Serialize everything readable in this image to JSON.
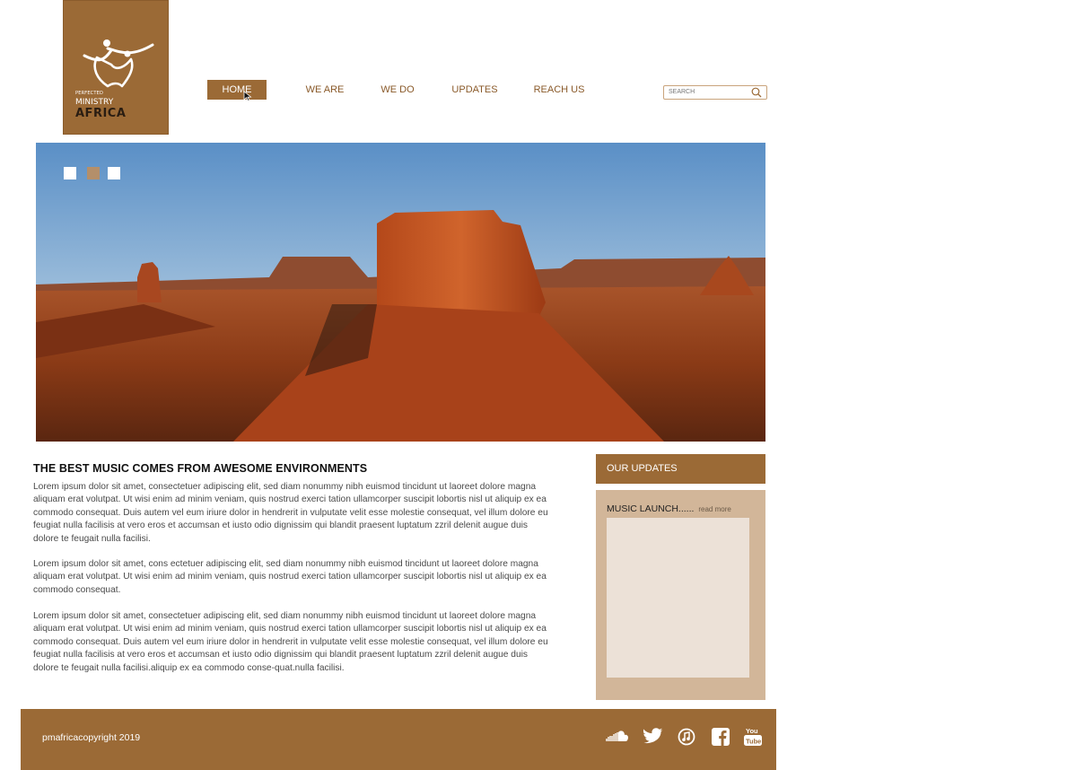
{
  "brand": {
    "tagline": "PERFECTED",
    "line1": "MINISTRY",
    "line2": "AFRICA"
  },
  "nav": {
    "items": [
      {
        "label": "HOME",
        "active": true
      },
      {
        "label": "WE ARE",
        "active": false
      },
      {
        "label": "WE DO",
        "active": false
      },
      {
        "label": "UPDATES",
        "active": false
      },
      {
        "label": "REACH US",
        "active": false
      }
    ]
  },
  "search": {
    "placeholder": "SEARCH",
    "icon": "search-icon"
  },
  "slider": {
    "slide_count": 3,
    "active_index": 1
  },
  "article": {
    "heading": "THE BEST MUSIC COMES FROM AWESOME ENVIRONMENTS",
    "paragraphs": [
      "Lorem ipsum dolor sit amet, consectetuer adipiscing elit, sed diam nonummy nibh euismod tincidunt ut laoreet dolore magna aliquam erat volutpat. Ut wisi enim ad minim veniam, quis nostrud exerci tation ullamcorper suscipit lobortis nisl ut aliquip ex ea commodo consequat. Duis autem vel eum iriure dolor in hendrerit in vulputate velit esse molestie consequat, vel illum dolore eu feugiat nulla facilisis at vero eros et accumsan et iusto odio dignissim qui blandit praesent luptatum zzril delenit augue duis dolore te feugait nulla facilisi.",
      "Lorem ipsum dolor sit amet, cons ectetuer adipiscing elit, sed diam nonummy nibh euismod tincidunt ut laoreet dolore magna aliquam erat volutpat. Ut wisi enim ad minim veniam, quis nostrud exerci tation ullamcorper suscipit lobortis nisl ut aliquip ex ea commodo consequat.",
      "Lorem ipsum dolor sit amet, consectetuer adipiscing elit, sed diam nonummy nibh euismod tincidunt ut laoreet dolore magna aliquam erat volutpat. Ut wisi enim ad minim veniam, quis nostrud exerci tation ullamcorper suscipit lobortis nisl ut aliquip ex ea commodo consequat. Duis autem vel eum iriure dolor in hendrerit in vulputate velit esse molestie consequat, vel illum dolore eu feugiat nulla facilisis at vero eros et accumsan et iusto odio dignissim qui blandit praesent luptatum zzril delenit augue duis dolore te feugait nulla facilisi.aliquip ex ea commodo conse-quat.nulla facilisi."
    ]
  },
  "updates": {
    "title": "OUR UPDATES",
    "item_title": "MUSIC LAUNCH......",
    "read_more": "read more"
  },
  "footer": {
    "copyright": "pmafricacopyright 2019",
    "social_icons": [
      "soundcloud-icon",
      "twitter-icon",
      "itunes-icon",
      "facebook-icon",
      "youtube-icon"
    ]
  },
  "colors": {
    "brand_brown": "#9b6a36",
    "panel_tan": "#d2b699",
    "panel_light": "#ece1d7"
  }
}
